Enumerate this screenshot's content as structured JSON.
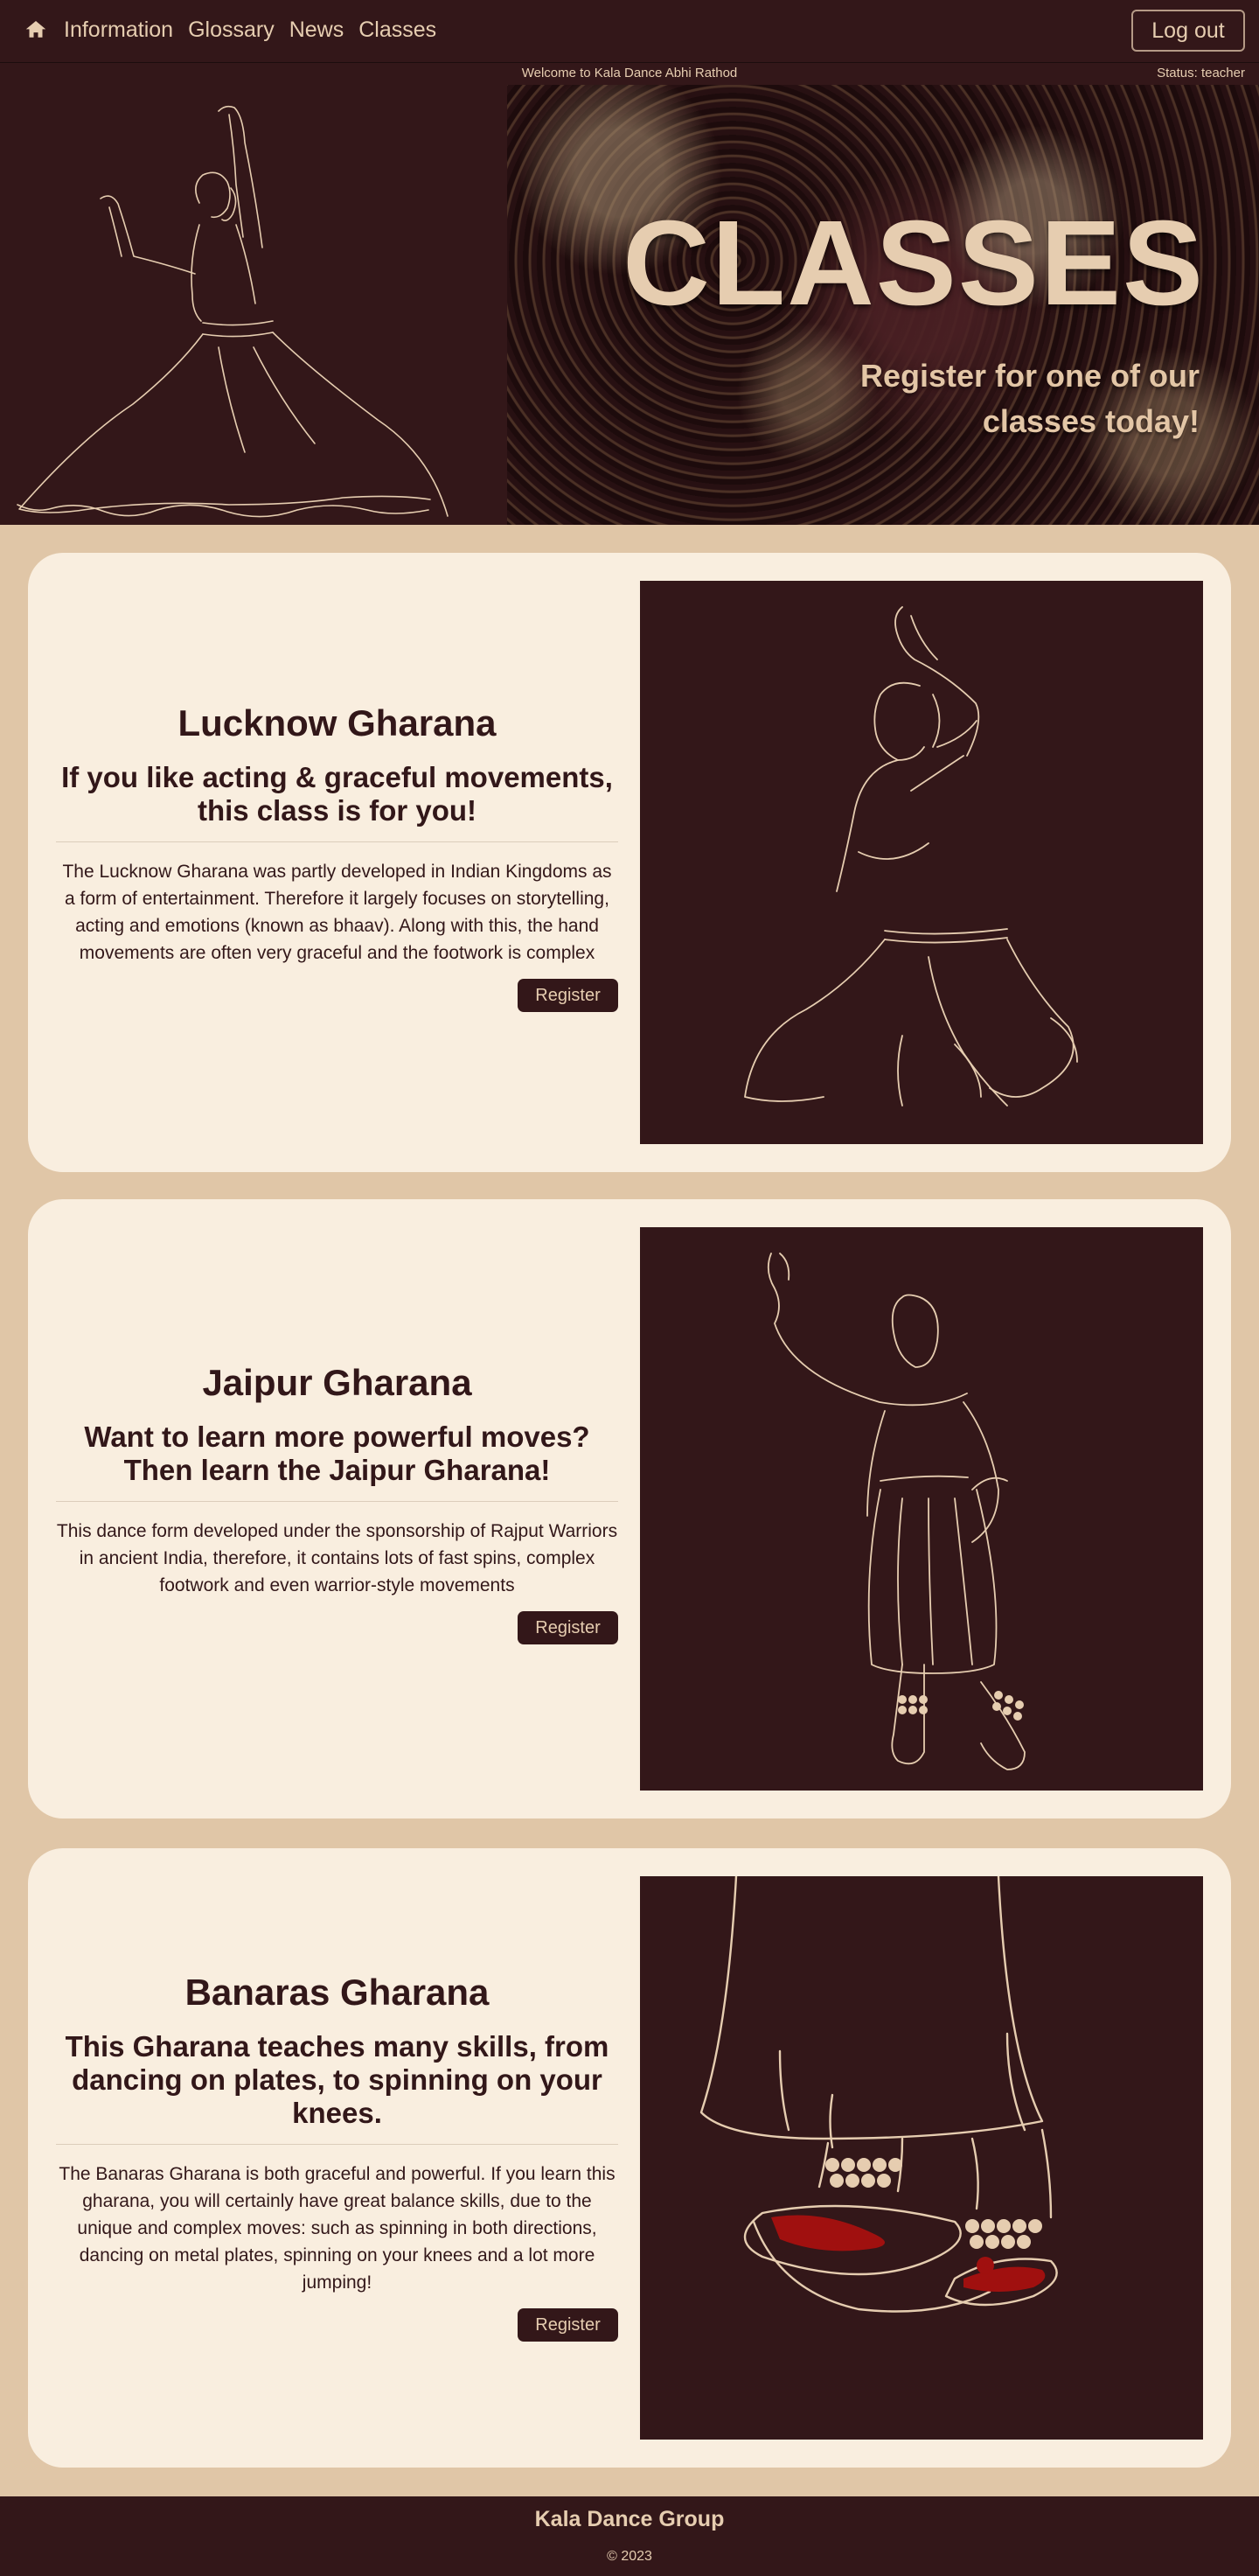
{
  "nav": {
    "home_icon": "home-icon",
    "links": [
      "Information",
      "Glossary",
      "News",
      "Classes"
    ],
    "logout_label": "Log out"
  },
  "status_strip": {
    "welcome": "Welcome to Kala Dance Abhi Rathod",
    "status": "Status: teacher"
  },
  "hero": {
    "title": "CLASSES",
    "subtitle": "Register for one of our classes today!"
  },
  "classes": [
    {
      "title": "Lucknow Gharana",
      "tagline": "If you like acting & graceful movements, this class is for you!",
      "description": "The Lucknow Gharana was partly developed in Indian Kingdoms as a form of entertainment. Therefore it largely focuses on storytelling, acting and emotions (known as bhaav). Along with this, the hand movements are often very graceful and the footwork is complex",
      "button": "Register"
    },
    {
      "title": "Jaipur Gharana",
      "tagline": "Want to learn more powerful moves? Then learn the Jaipur Gharana!",
      "description": "This dance form developed under the sponsorship of Rajput Warriors in ancient India, therefore, it contains lots of fast spins, complex footwork and even warrior-style movements",
      "button": "Register"
    },
    {
      "title": "Banaras Gharana",
      "tagline": "This Gharana teaches many skills, from dancing on plates, to spinning on your knees.",
      "description": "The Banaras Gharana is both graceful and powerful. If you learn this gharana, you will certainly have great balance skills, due to the unique and complex moves: such as spinning in both directions, dancing on metal plates, spinning on your knees and a lot more jumping!",
      "button": "Register"
    }
  ],
  "footer": {
    "name": "Kala Dance Group",
    "copyright": "© 2023"
  },
  "colors": {
    "dark": "#331719",
    "cream": "#f9eedf",
    "tan": "#e0c6a7",
    "line": "#e6cdb0",
    "accent_red": "#a0100f"
  }
}
